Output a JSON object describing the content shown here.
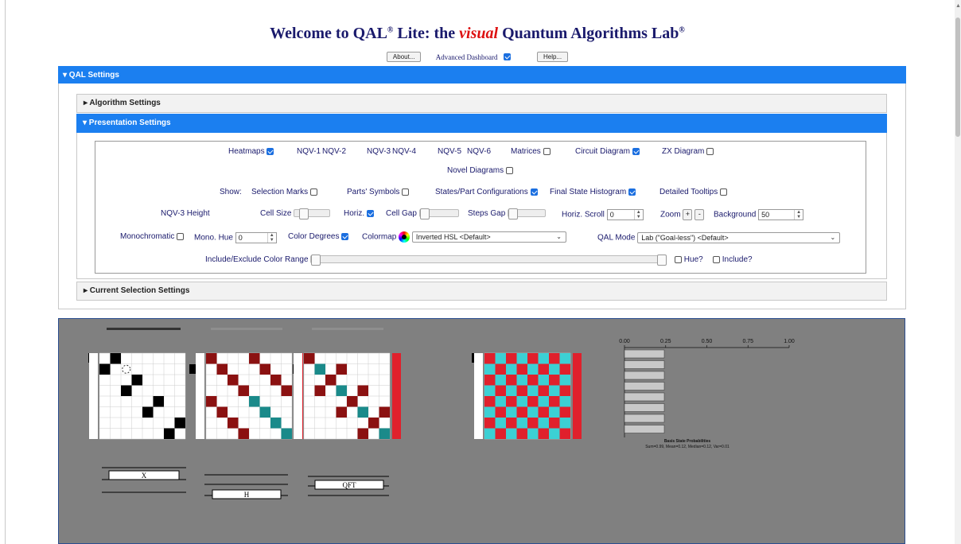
{
  "title": {
    "prefix": "Welcome to QAL",
    "reg1": "®",
    "middle": " Lite: the ",
    "visual": "visual",
    "suffix": " Quantum Algorithms Lab",
    "reg2": "®"
  },
  "topbar": {
    "about_label": "About...",
    "advanced_label": "Advanced Dashboard",
    "advanced_checked": true,
    "help_label": "Help..."
  },
  "settings": {
    "qal_header": "▾ QAL Settings",
    "algorithm_header": "▸ Algorithm Settings",
    "presentation_header": "▾ Presentation Settings",
    "current_header": "▸ Current Selection Settings"
  },
  "presentation": {
    "row1": {
      "heatmaps": "Heatmaps",
      "nqv1": "NQV-1",
      "nqv2": "NQV-2",
      "nqv3": "NQV-3",
      "nqv4": "NQV-4",
      "nqv5": "NQV-5",
      "nqv6": "NQV-6",
      "matrices": "Matrices",
      "circuit": "Circuit Diagram",
      "zx": "ZX Diagram"
    },
    "row2": {
      "novel": "Novel Diagrams"
    },
    "row3": {
      "show": "Show:",
      "selection_marks": "Selection Marks",
      "parts_symbols": "Parts' Symbols",
      "states": "States/Part Configurations",
      "histogram": "Final State Histogram",
      "tooltips": "Detailed Tooltips"
    },
    "row4": {
      "nqv3_height": "NQV-3 Height",
      "cell_size": "Cell Size",
      "horiz": "Horiz.",
      "cell_gap": "Cell Gap",
      "steps_gap": "Steps Gap",
      "horiz_scroll": "Horiz. Scroll",
      "horiz_scroll_value": "0",
      "zoom": "Zoom",
      "zoom_plus": "+",
      "zoom_minus": "-",
      "background": "Background",
      "background_value": "50"
    },
    "row5": {
      "monochromatic": "Monochromatic",
      "mono_hue": "Mono. Hue",
      "mono_hue_value": "0",
      "color_degrees": "Color Degrees",
      "colormap": "Colormap",
      "colormap_value": "Inverted HSL <Default>",
      "qal_mode": "QAL Mode",
      "qal_mode_value": "Lab (\"Goal-less\") <Default>"
    },
    "row6": {
      "include_exclude": "Include/Exclude Color Range",
      "hue": "Hue?",
      "include": "Include?"
    }
  },
  "viz": {
    "colors": {
      "dark_red": "#8b1111",
      "red": "#e0202c",
      "teal": "#1a8a8a",
      "cyan": "#3cd0d4"
    },
    "histogram": {
      "ticks": [
        "0.00",
        "0.25",
        "0.50",
        "0.75",
        "1.00"
      ],
      "title": "Basis State Probabilities",
      "stats": "Sum=0.99, Mean=0.12, Median=0.12, Var=0.01"
    },
    "gates": {
      "x": "X",
      "h": "H",
      "qft": "QFT"
    }
  }
}
